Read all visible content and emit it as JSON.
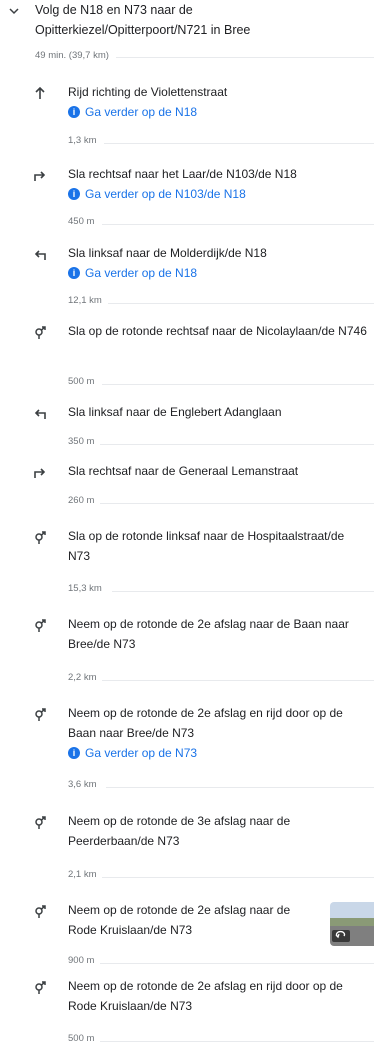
{
  "header": {
    "title": "Volg de N18 en N73 naar de Opitterkiezel/Opitterpoort/N721 in Bree",
    "summary": "49 min. (39,7 km)"
  },
  "steps": [
    {
      "icon": "straight-arrow-icon",
      "text": "Rijd richting de Violettenstraat",
      "hint": "Ga verder op de N18",
      "distance": "1,3 km"
    },
    {
      "icon": "turn-right-icon",
      "text": "Sla rechtsaf naar het Laar/de N103/de N18",
      "hint": "Ga verder op de N103/de N18",
      "distance": "450 m"
    },
    {
      "icon": "turn-left-icon",
      "text": "Sla linksaf naar de Molderdijk/de N18",
      "hint": "Ga verder op de N18",
      "distance": "12,1 km"
    },
    {
      "icon": "roundabout-icon",
      "text": "Sla op de rotonde rechtsaf naar de Nicolaylaan/de N746",
      "distance": "500 m"
    },
    {
      "icon": "turn-left-icon",
      "text": "Sla linksaf naar de Englebert Adanglaan",
      "distance": "350 m"
    },
    {
      "icon": "turn-right-icon",
      "text": "Sla rechtsaf naar de Generaal Lemanstraat",
      "distance": "260 m"
    },
    {
      "icon": "roundabout-icon",
      "text": "Sla op de rotonde linksaf naar de Hospitaalstraat/de N73",
      "distance": "15,3 km"
    },
    {
      "icon": "roundabout-icon",
      "text": "Neem op de rotonde de 2e afslag naar de Baan naar Bree/de N73",
      "distance": "2,2 km"
    },
    {
      "icon": "roundabout-icon",
      "text": "Neem op de rotonde de 2e afslag en rijd door op de Baan naar Bree/de N73",
      "hint": "Ga verder op de N73",
      "distance": "3,6 km"
    },
    {
      "icon": "roundabout-icon",
      "text": "Neem op de rotonde de 3e afslag naar de Peerderbaan/de N73",
      "distance": "2,1 km"
    },
    {
      "icon": "roundabout-icon",
      "text": "Neem op de rotonde de 2e afslag naar de Rode Kruislaan/de N73",
      "distance": "900 m",
      "has_thumbnail": true
    },
    {
      "icon": "roundabout-icon",
      "text": "Neem op de rotonde de 2e afslag en rijd door op de Rode Kruislaan/de N73",
      "distance": "500 m"
    }
  ],
  "colors": {
    "link": "#1a73e8",
    "text": "#202124",
    "muted": "#70757a"
  }
}
